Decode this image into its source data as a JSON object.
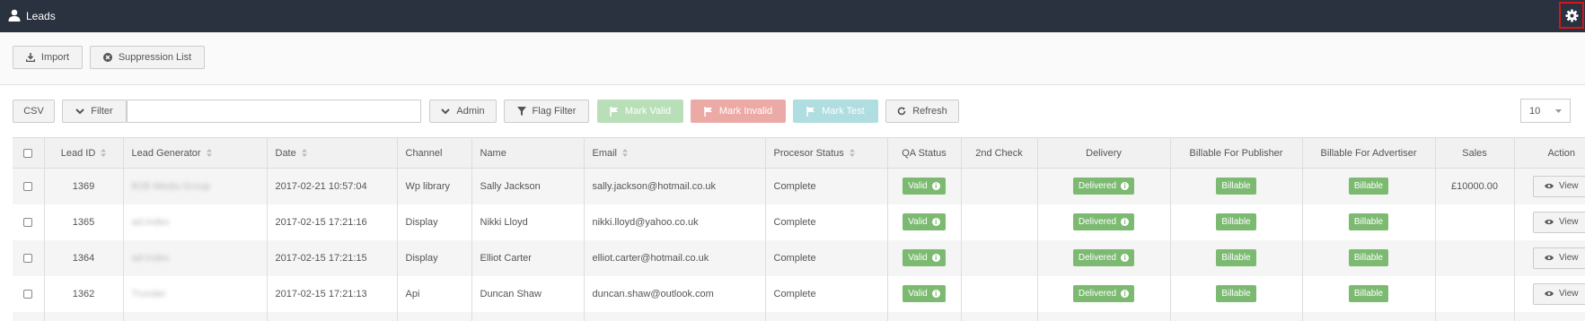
{
  "header": {
    "title": "Leads",
    "user_icon": "user-icon",
    "settings_icon": "gear-icon"
  },
  "toolbar": {
    "import_label": "Import",
    "suppression_label": "Suppression List"
  },
  "filters": {
    "csv_label": "CSV",
    "filter_label": "Filter",
    "filter_value": "",
    "admin_label": "Admin",
    "flag_filter_label": "Flag Filter",
    "mark_valid_label": "Mark Valid",
    "mark_invalid_label": "Mark Invalid",
    "mark_test_label": "Mark Test",
    "refresh_label": "Refresh",
    "per_page": "10"
  },
  "colors": {
    "header_bg": "#2a323f",
    "valid": "#7cba72",
    "mark_valid": "#b9dfb9",
    "mark_invalid": "#ecaaa6",
    "mark_test": "#afdde0",
    "highlight": "#d6141d"
  },
  "table": {
    "columns": [
      "",
      "Lead ID",
      "Lead Generator",
      "Date",
      "Channel",
      "Name",
      "Email",
      "Procesor Status",
      "QA Status",
      "2nd Check",
      "Delivery",
      "Billable For Publisher",
      "Billable For Advertiser",
      "Sales",
      "Action"
    ],
    "rows": [
      {
        "lead_id": "1369",
        "lead_generator": "B2B Media Group",
        "date": "2017-02-21 10:57:04",
        "channel": "Wp library",
        "name": "Sally Jackson",
        "email": "sally.jackson@hotmail.co.uk",
        "processor_status": "Complete",
        "qa_status": "Valid",
        "second_check": "",
        "delivery": "Delivered",
        "billable_publisher": "Billable",
        "billable_advertiser": "Billable",
        "sales": "£10000.00",
        "action": "View"
      },
      {
        "lead_id": "1365",
        "lead_generator": "ad-index",
        "date": "2017-02-15 17:21:16",
        "channel": "Display",
        "name": "Nikki Lloyd",
        "email": "nikki.lloyd@yahoo.co.uk",
        "processor_status": "Complete",
        "qa_status": "Valid",
        "second_check": "",
        "delivery": "Delivered",
        "billable_publisher": "Billable",
        "billable_advertiser": "Billable",
        "sales": "",
        "action": "View"
      },
      {
        "lead_id": "1364",
        "lead_generator": "ad-index",
        "date": "2017-02-15 17:21:15",
        "channel": "Display",
        "name": "Elliot Carter",
        "email": "elliot.carter@hotmail.co.uk",
        "processor_status": "Complete",
        "qa_status": "Valid",
        "second_check": "",
        "delivery": "Delivered",
        "billable_publisher": "Billable",
        "billable_advertiser": "Billable",
        "sales": "",
        "action": "View"
      },
      {
        "lead_id": "1362",
        "lead_generator": "Trunder",
        "date": "2017-02-15 17:21:13",
        "channel": "Api",
        "name": "Duncan Shaw",
        "email": "duncan.shaw@outlook.com",
        "processor_status": "Complete",
        "qa_status": "Valid",
        "second_check": "",
        "delivery": "Delivered",
        "billable_publisher": "Billable",
        "billable_advertiser": "Billable",
        "sales": "",
        "action": "View"
      }
    ]
  }
}
